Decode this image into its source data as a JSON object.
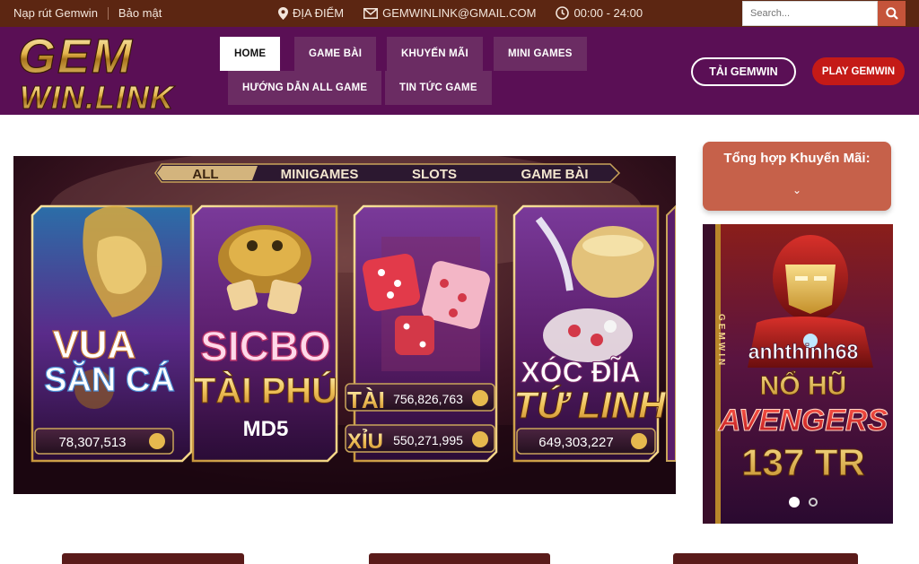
{
  "topbar": {
    "links": [
      "Nạp rút Gemwin",
      "Bảo mật"
    ],
    "location": "ĐỊA ĐIỂM",
    "email": "GEMWINLINK@GMAIL.COM",
    "hours": "00:00 - 24:00",
    "search_placeholder": "Search..."
  },
  "logo": {
    "line1": "GEM",
    "line2": "WIN.LINK"
  },
  "nav": {
    "items": [
      "HOME",
      "GAME BÀI",
      "KHUYẾN MÃI",
      "MINI GAMES",
      "HƯỚNG DẪN ALL GAME",
      "TIN TỨC GAME"
    ],
    "active": "HOME"
  },
  "header_buttons": {
    "download": "TẢI GEMWIN",
    "play": "PLAY GEMWIN"
  },
  "banner": {
    "tabs": [
      "ALL",
      "MINIGAMES",
      "SLOTS",
      "GAME BÀI"
    ],
    "games": [
      {
        "name_line1": "VUA",
        "name_line2": "SĂN CÁ",
        "amount": "78,307,513"
      },
      {
        "name_line1": "SICBO",
        "name_line2": "TÀI PHÚ",
        "name_line3": "MD5"
      },
      {
        "label_tai": "TÀI",
        "amount_tai": "756,826,763",
        "label_xiu": "XỈU",
        "amount_xiu": "550,271,995"
      },
      {
        "name_line1": "XÓC ĐĨA",
        "name_line2": "TỨ LINH",
        "amount": "649,303,227"
      }
    ]
  },
  "promo": {
    "title": "Tổng hợp Khuyến Mãi:",
    "chevron": "⌄"
  },
  "side_banner": {
    "vertical_text": "GEMWIN",
    "user": "anhthinh68",
    "line1": "NỔ HŨ",
    "line2": "AVENGERS",
    "line3": "137 TR",
    "slides": 2,
    "active_slide": 1
  },
  "colors": {
    "topbar": "#5c2612",
    "header": "#5a0f55",
    "nav_item": "#6b2c63",
    "accent": "#c5543a",
    "play_button": "#c41a17"
  }
}
